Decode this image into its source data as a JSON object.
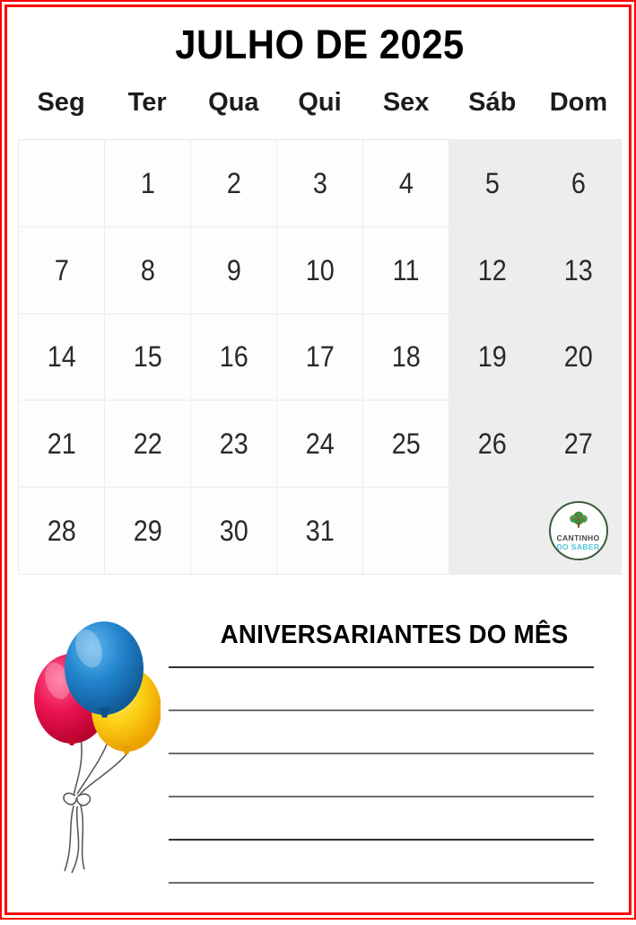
{
  "frame": {
    "border_color": "#fe0000"
  },
  "header": {
    "month_title": "JULHO DE 2025"
  },
  "calendar": {
    "weekdays": [
      "Seg",
      "Ter",
      "Qua",
      "Qui",
      "Sex",
      "Sáb",
      "Dom"
    ],
    "weekend_columns": [
      5,
      6
    ],
    "weekend_bg": "#ededed",
    "weeks": [
      [
        "",
        "1",
        "2",
        "3",
        "4",
        "5",
        "6"
      ],
      [
        "7",
        "8",
        "9",
        "10",
        "11",
        "12",
        "13"
      ],
      [
        "14",
        "15",
        "16",
        "17",
        "18",
        "19",
        "20"
      ],
      [
        "21",
        "22",
        "23",
        "24",
        "25",
        "26",
        "27"
      ],
      [
        "28",
        "29",
        "30",
        "31",
        "",
        "",
        ""
      ]
    ]
  },
  "logo": {
    "line1": "CANTINHO",
    "line2": "DO SABER",
    "icon": "tree-icon",
    "tree_color": "#3f9142",
    "text_color_1": "#464646",
    "text_color_2": "#4ec3d9"
  },
  "birthdays": {
    "title": "ANIVERSARIANTES DO MÊS",
    "illustration": "balloons-icon",
    "balloon_colors": [
      "#1f7ec4",
      "#e8174b",
      "#fcd116"
    ],
    "line_count": 6
  }
}
